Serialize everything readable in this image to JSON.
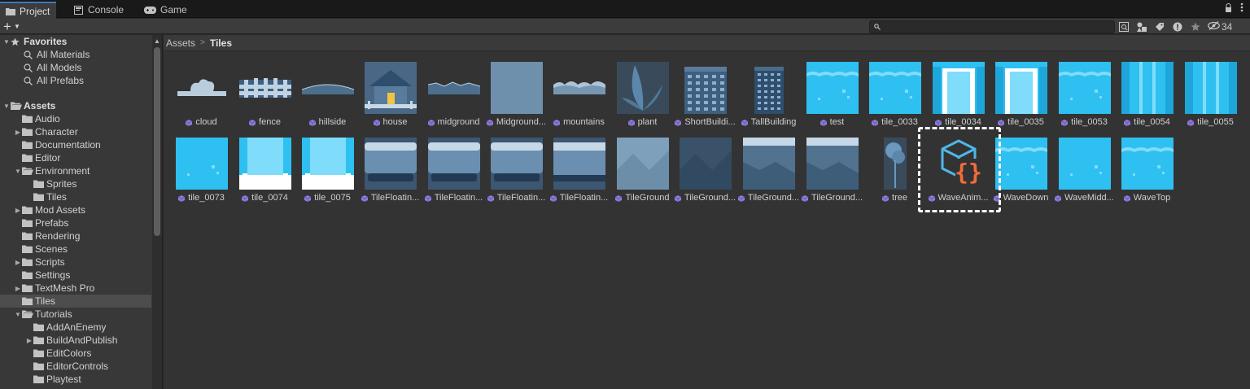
{
  "tabs": [
    {
      "label": "Project",
      "icon": "folder-icon",
      "active": true
    },
    {
      "label": "Console",
      "icon": "console-icon",
      "active": false
    },
    {
      "label": "Game",
      "icon": "gamepad-icon",
      "active": false
    }
  ],
  "toolbar": {
    "add_label": "+",
    "search_placeholder": "",
    "hidden_count": "34"
  },
  "sidebar": {
    "favorites": {
      "label": "Favorites",
      "items": [
        "All Materials",
        "All Models",
        "All Prefabs"
      ]
    },
    "assets": {
      "label": "Assets",
      "items": [
        {
          "label": "Audio",
          "depth": 1,
          "expander": "none"
        },
        {
          "label": "Character",
          "depth": 1,
          "expander": "collapsed"
        },
        {
          "label": "Documentation",
          "depth": 1,
          "expander": "none"
        },
        {
          "label": "Editor",
          "depth": 1,
          "expander": "none"
        },
        {
          "label": "Environment",
          "depth": 1,
          "expander": "expanded"
        },
        {
          "label": "Sprites",
          "depth": 2,
          "expander": "none"
        },
        {
          "label": "Tiles",
          "depth": 2,
          "expander": "none"
        },
        {
          "label": "Mod Assets",
          "depth": 1,
          "expander": "collapsed"
        },
        {
          "label": "Prefabs",
          "depth": 1,
          "expander": "none"
        },
        {
          "label": "Rendering",
          "depth": 1,
          "expander": "none"
        },
        {
          "label": "Scenes",
          "depth": 1,
          "expander": "none"
        },
        {
          "label": "Scripts",
          "depth": 1,
          "expander": "collapsed"
        },
        {
          "label": "Settings",
          "depth": 1,
          "expander": "none"
        },
        {
          "label": "TextMesh Pro",
          "depth": 1,
          "expander": "collapsed"
        },
        {
          "label": "Tiles",
          "depth": 1,
          "expander": "none",
          "selected": true
        },
        {
          "label": "Tutorials",
          "depth": 1,
          "expander": "expanded"
        },
        {
          "label": "AddAnEnemy",
          "depth": 2,
          "expander": "none"
        },
        {
          "label": "BuildAndPublish",
          "depth": 2,
          "expander": "collapsed"
        },
        {
          "label": "EditColors",
          "depth": 2,
          "expander": "none"
        },
        {
          "label": "EditorControls",
          "depth": 2,
          "expander": "none"
        },
        {
          "label": "Playtest",
          "depth": 2,
          "expander": "none"
        }
      ]
    }
  },
  "breadcrumb": [
    "Assets",
    "Tiles"
  ],
  "assets_row1": [
    {
      "name": "cloud",
      "thumb": "cloud"
    },
    {
      "name": "fence",
      "thumb": "fence"
    },
    {
      "name": "hillside",
      "thumb": "hillside"
    },
    {
      "name": "house",
      "thumb": "house"
    },
    {
      "name": "midground",
      "thumb": "midground"
    },
    {
      "name": "Midground...",
      "thumb": "plain"
    },
    {
      "name": "mountains",
      "thumb": "mountains"
    },
    {
      "name": "plant",
      "thumb": "plant"
    },
    {
      "name": "ShortBuildi...",
      "thumb": "shortbuilding"
    },
    {
      "name": "TallBuilding",
      "thumb": "tallbuilding"
    },
    {
      "name": "test",
      "thumb": "water-top"
    },
    {
      "name": "tile_0033",
      "thumb": "water-top"
    },
    {
      "name": "tile_0034",
      "thumb": "water-column-foam"
    },
    {
      "name": "tile_0035",
      "thumb": "water-column-foam"
    },
    {
      "name": "tile_0053",
      "thumb": "water-top"
    },
    {
      "name": "tile_0054",
      "thumb": "water-column"
    },
    {
      "name": "tile_0055",
      "thumb": "water-column"
    }
  ],
  "assets_row2": [
    {
      "name": "tile_0073",
      "thumb": "water"
    },
    {
      "name": "tile_0074",
      "thumb": "water-column-bottom"
    },
    {
      "name": "tile_0075",
      "thumb": "water-column-bottom"
    },
    {
      "name": "TileFloatin...",
      "thumb": "floating"
    },
    {
      "name": "TileFloatin...",
      "thumb": "floating"
    },
    {
      "name": "TileFloatin...",
      "thumb": "floating"
    },
    {
      "name": "TileFloatin...",
      "thumb": "floating2"
    },
    {
      "name": "TileGround",
      "thumb": "ground-light"
    },
    {
      "name": "TileGround...",
      "thumb": "ground-dark"
    },
    {
      "name": "TileGround...",
      "thumb": "ground-mid"
    },
    {
      "name": "TileGround...",
      "thumb": "ground-mid"
    },
    {
      "name": "tree",
      "thumb": "tree"
    },
    {
      "name": "WaveAnim...",
      "thumb": "script"
    },
    {
      "name": "WaveDown",
      "thumb": "water-top"
    },
    {
      "name": "WaveMidd...",
      "thumb": "water"
    },
    {
      "name": "WaveTop",
      "thumb": "water-top"
    }
  ],
  "colors": {
    "accent": "#3a79bb",
    "water": "#2ec0f0",
    "cube": "#8f7bd9",
    "script_outline": "#4db8e8",
    "script_brace": "#f26b3a"
  }
}
